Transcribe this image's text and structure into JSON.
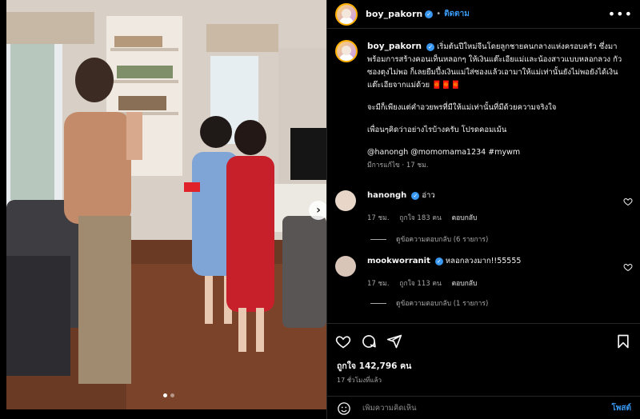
{
  "header": {
    "username": "boy_pakorn",
    "separator": "•",
    "follow_label": "ติดตาม",
    "more_icon": "more-horizontal-icon"
  },
  "caption": {
    "username": "boy_pakorn",
    "text1": "เริ่มต้นปีใหม่จีนโดยลูกชายคนกลางแห่งครอบครัว ซึ่งมาพร้อมการสร้างคอนเท็นหลอกๆ ให้เงินแต๊ะเอียแม่และน้องสาวแบบหลอกลวง กัวซองตุงไม่พอ ก็เลยยืมปึ้งเงินแม่ใส่ซองแล้วเอามาให้แม่เท่านั้นยังไม่พอยังได้เงินแต๊ะเอียจากแม่ด้วย 🧧🧧🧧",
    "text2": "จะมีก็เพียงแต่คำอวยพรที่มีให้แม่เท่านั้นที่มีด้วยความจริงใจ",
    "text3": "เพื่อนๆคิดว่าอย่างไรบ้างครับ โปรดคอมเม้น",
    "mentions": "@hanongh @momomama1234 #mywm",
    "edited": "มีการแก้ไข · 17 ชม."
  },
  "comments": [
    {
      "username": "hanongh",
      "text": "อ่าว",
      "time": "17 ชม.",
      "likes": "ถูกใจ 183 คน",
      "reply_label": "ตอบกลับ",
      "view_replies": "ดูข้อความตอบกลับ (6 รายการ)",
      "avatar_color": "#e8d6c8"
    },
    {
      "username": "mookworranit",
      "text": "หลอกลวงมาก!!55555",
      "time": "17 ชม.",
      "likes": "ถูกใจ 113 คน",
      "reply_label": "ตอบกลับ",
      "view_replies": "ดูข้อความตอบกลับ (1 รายการ)",
      "avatar_color": "#d9c4b8"
    }
  ],
  "actions": {
    "like_icon": "heart-icon",
    "comment_icon": "comment-icon",
    "share_icon": "share-icon",
    "save_icon": "bookmark-icon",
    "likes_text": "ถูกใจ 142,796 คน",
    "time_text": "17 ชั่วโมงที่แล้ว"
  },
  "comment_box": {
    "placeholder": "เพิ่มความคิดเห็น",
    "post_label": "โพสต์",
    "emoji_icon": "emoji-icon"
  },
  "carousel": {
    "total": 2,
    "current": 1
  },
  "colors": {
    "accent": "#3897f0",
    "background": "#000000",
    "border": "#262626"
  }
}
